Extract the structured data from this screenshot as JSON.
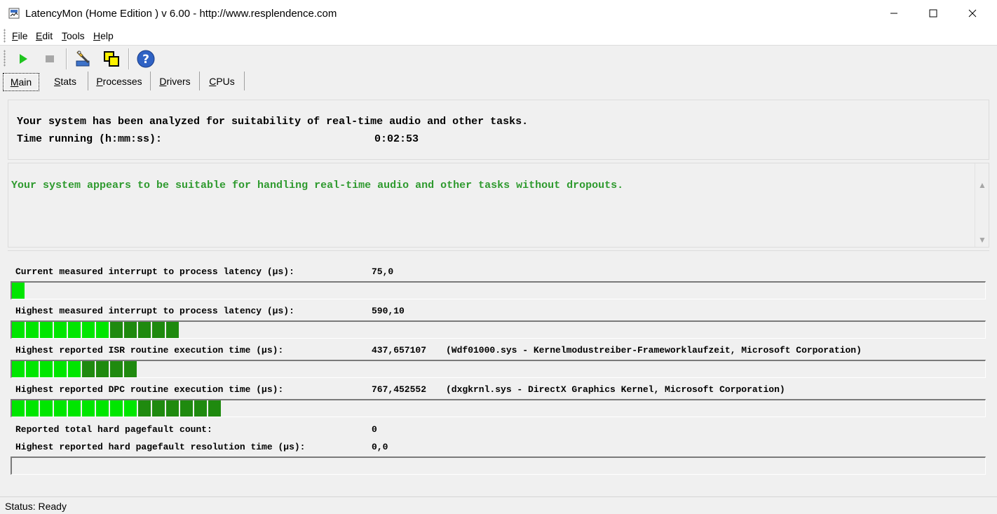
{
  "window": {
    "title": "LatencyMon  (Home Edition )  v 6.00 - http://www.resplendence.com"
  },
  "menu": [
    {
      "label": "File",
      "key": "F",
      "rest": "ile"
    },
    {
      "label": "Edit",
      "key": "E",
      "rest": "dit"
    },
    {
      "label": "Tools",
      "key": "T",
      "rest": "ools"
    },
    {
      "label": "Help",
      "key": "H",
      "rest": "elp"
    }
  ],
  "toolbar": [
    "play-icon",
    "stop-icon",
    "tools-icon",
    "windows-icon",
    "help-icon"
  ],
  "tabs": [
    {
      "label": "Main",
      "key": "M",
      "rest": "ain",
      "active": true
    },
    {
      "label": "Stats",
      "key": "S",
      "rest": "tats",
      "active": false
    },
    {
      "label": "Processes",
      "key": "P",
      "rest": "rocesses",
      "active": false
    },
    {
      "label": "Drivers",
      "key": "D",
      "rest": "rivers",
      "active": false
    },
    {
      "label": "CPUs",
      "key": "C",
      "rest": "PUs",
      "active": false
    }
  ],
  "summary": {
    "line1": "Your system has been analyzed for suitability of real-time audio and other tasks.",
    "time_label": "Time running (h:mm:ss):",
    "time_value": "0:02:53"
  },
  "conclusion": "Your system appears to be suitable for handling real-time audio and other tasks without dropouts.",
  "metrics": {
    "current_latency": {
      "label": "Current measured interrupt to process latency (µs):",
      "value": "75,0",
      "detail": "",
      "fill_fraction": 0.013
    },
    "highest_latency": {
      "label": "Highest measured interrupt to process latency (µs):",
      "value": "590,10",
      "detail": "",
      "fill_fraction": 0.17
    },
    "isr": {
      "label": "Highest reported ISR routine execution time (µs):",
      "value": "437,657107",
      "detail": "(Wdf01000.sys - Kernelmodustreiber-Frameworklaufzeit, Microsoft Corporation)",
      "fill_fraction": 0.127
    },
    "dpc": {
      "label": "Highest reported DPC routine execution time (µs):",
      "value": "767,452552",
      "detail": "(dxgkrnl.sys - DirectX Graphics Kernel, Microsoft Corporation)",
      "fill_fraction": 0.213
    },
    "pagefault_count": {
      "label": "Reported total hard pagefault count:",
      "value": "0"
    },
    "pagefault_time": {
      "label": "Highest reported hard pagefault resolution time (µs):",
      "value": "0,0",
      "fill_fraction": 0
    }
  },
  "status": {
    "text": "Status: Ready"
  },
  "colors": {
    "bar_light": "#00e600",
    "bar_dark": "#1f8a0f",
    "ok_text": "#2e9a2e"
  }
}
